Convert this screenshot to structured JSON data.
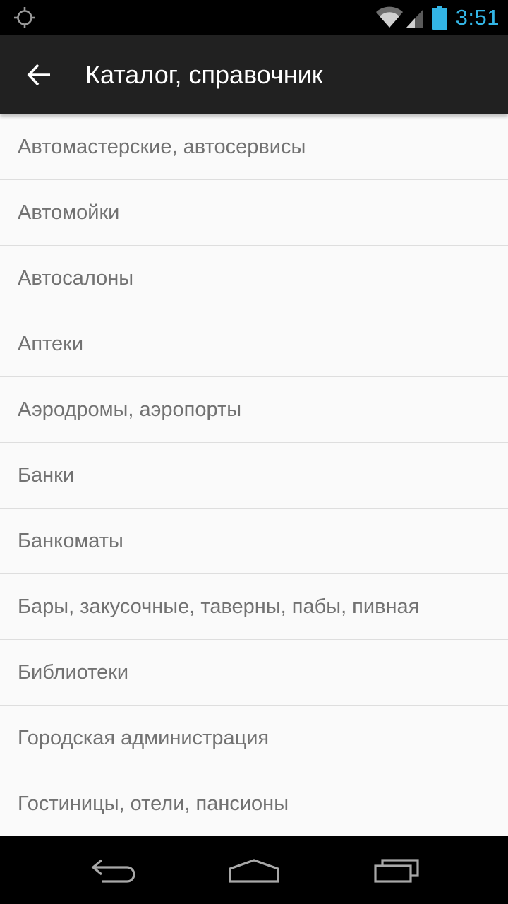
{
  "status_bar": {
    "time": "3:51",
    "time_color": "#33b5e5",
    "icons": [
      "location-icon",
      "wifi-icon",
      "signal-icon",
      "battery-icon"
    ]
  },
  "app_bar": {
    "back_icon": "arrow-back-icon",
    "title": "Каталог, справочник",
    "background": "#212121"
  },
  "list": {
    "items": [
      {
        "label": "Автомастерские, автосервисы"
      },
      {
        "label": "Автомойки"
      },
      {
        "label": "Автосалоны"
      },
      {
        "label": "Аптеки"
      },
      {
        "label": "Аэродромы, аэропорты"
      },
      {
        "label": "Банки"
      },
      {
        "label": "Банкоматы"
      },
      {
        "label": "Бары, закусочные, таверны, пабы, пивная"
      },
      {
        "label": "Библиотеки"
      },
      {
        "label": "Городская администрация"
      },
      {
        "label": "Гостиницы, отели, пансионы"
      }
    ]
  },
  "nav_bar": {
    "buttons": [
      "nav-back-icon",
      "nav-home-icon",
      "nav-recents-icon"
    ]
  }
}
